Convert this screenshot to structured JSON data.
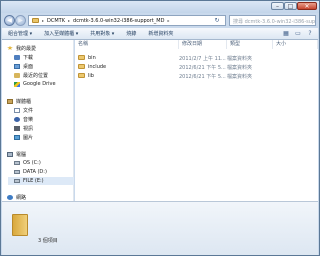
{
  "window": {
    "minimize": "–",
    "maximize": "□",
    "close": "✕"
  },
  "address": {
    "back": "◀",
    "forward": "▶",
    "crumbs": [
      "DCMTK",
      "dcmtk-3.6.0-win32-i386-support_MD"
    ],
    "separator": "▸",
    "refresh": "↻",
    "search_placeholder": "搜尋 dcmtk-3.6.0-win32-i386-support..."
  },
  "toolbar": {
    "items": [
      "組合管理 ▾",
      "加入至媒體櫃 ▾",
      "共用對象 ▾",
      "燒錄",
      "新增資料夾"
    ]
  },
  "nav": {
    "favorites": "我的最愛",
    "downloads": "下載",
    "desktop": "桌面",
    "recent": "最近的位置",
    "gdrive": "Google Drive",
    "libraries": "媒體櫃",
    "docs": "文件",
    "music": "音樂",
    "video": "視訊",
    "pictures": "圖片",
    "computer": "電腦",
    "os": "OS (C:)",
    "data": "DATA (D:)",
    "file": "FILE (E:)",
    "network": "網路"
  },
  "columns": {
    "name": "名稱",
    "date": "修改日期",
    "type": "類型",
    "size": "大小"
  },
  "files": [
    {
      "name": "bin",
      "date": "2011/2/7 上午 11...",
      "type": "檔案資料夾"
    },
    {
      "name": "include",
      "date": "2012/6/21 下午 5...",
      "type": "檔案資料夾"
    },
    {
      "name": "lib",
      "date": "2012/6/21 下午 5...",
      "type": "檔案資料夾"
    }
  ],
  "details": {
    "count": "3 個項目"
  }
}
